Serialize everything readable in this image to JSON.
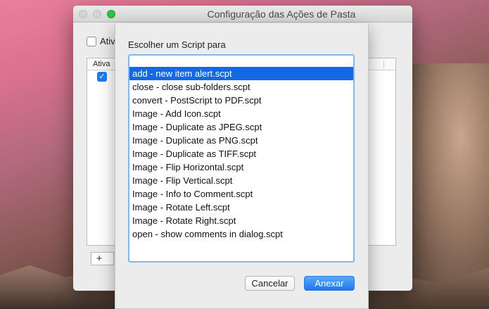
{
  "window": {
    "title": "Configuração das Ações de Pasta",
    "enable_label": "Ativ",
    "table": {
      "column_header": "Ativa",
      "row_checked_glyph": "✓"
    },
    "buttons": {
      "add": "+"
    }
  },
  "sheet": {
    "prompt": "Escolher um Script para",
    "selected_index": 1,
    "items": [
      "",
      "add - new item alert.scpt",
      "close - close sub-folders.scpt",
      "convert - PostScript to PDF.scpt",
      "Image - Add Icon.scpt",
      "Image - Duplicate as JPEG.scpt",
      "Image - Duplicate as PNG.scpt",
      "Image - Duplicate as TIFF.scpt",
      "Image - Flip Horizontal.scpt",
      "Image - Flip Vertical.scpt",
      "Image - Info to Comment.scpt",
      "Image - Rotate Left.scpt",
      "Image - Rotate Right.scpt",
      "open - show comments in dialog.scpt"
    ],
    "buttons": {
      "cancel": "Cancelar",
      "attach": "Anexar"
    }
  },
  "colors": {
    "selection": "#1269e3",
    "default_button": "#1e78ee",
    "focus_ring": "#83b5ee",
    "zoom_button": "#2fc240"
  }
}
